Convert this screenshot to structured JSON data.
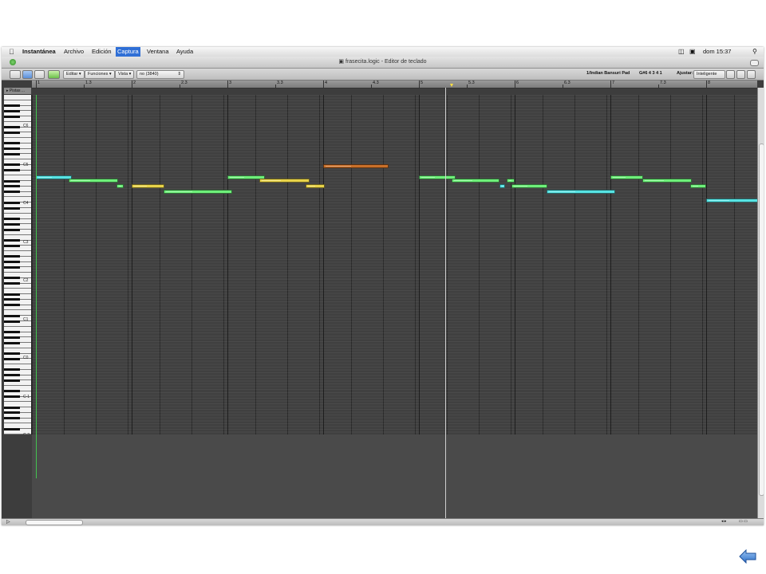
{
  "menubar": {
    "items": [
      "Instantánea",
      "Archivo",
      "Edición",
      "Captura",
      "Ventana",
      "Ayuda"
    ],
    "active_index": 3,
    "clock": "dom 15:37"
  },
  "window": {
    "title": "frasecita.logic - Editor de teclado"
  },
  "toolbar": {
    "edit_menu": "Editar",
    "functions_menu": "Funciones",
    "view_menu": "Vista",
    "quantize_value": "no (3840)",
    "track_name": "1/Indian Bansuri Pad",
    "position": "G#6  4 3 4 1",
    "snap_label": "Ajustar:",
    "snap_value": "Inteligente"
  },
  "ruler": {
    "labels": [
      "1",
      "1.3",
      "2",
      "2.3",
      "3",
      "3.3",
      "4",
      "4.3",
      "5",
      "5.3",
      "6",
      "6.3",
      "7",
      "7.3",
      "8"
    ]
  },
  "inspector": {
    "tab_label": "Pistas ..."
  },
  "keyboard": {
    "octaves": [
      "C6",
      "C5",
      "C4",
      "C3",
      "C2",
      "C1",
      "C0",
      "C-1",
      "C-2"
    ]
  },
  "notes": [
    {
      "start": 0.0,
      "length": 0.375,
      "pitch": 76,
      "color": "#57e3e3"
    },
    {
      "start": 0.34,
      "length": 0.52,
      "pitch": 75,
      "color": "#6ef07a"
    },
    {
      "start": 0.84,
      "length": 0.08,
      "pitch": 73,
      "color": "#6ef07a"
    },
    {
      "start": 1.0,
      "length": 0.34,
      "pitch": 73,
      "color": "#e8d34a"
    },
    {
      "start": 1.33,
      "length": 0.72,
      "pitch": 71,
      "color": "#6ef07a"
    },
    {
      "start": 2.0,
      "length": 0.39,
      "pitch": 76,
      "color": "#6ef07a"
    },
    {
      "start": 2.33,
      "length": 0.53,
      "pitch": 75,
      "color": "#e8d34a"
    },
    {
      "start": 2.82,
      "length": 0.2,
      "pitch": 73,
      "color": "#e8d34a"
    },
    {
      "start": 3.0,
      "length": 0.68,
      "pitch": 80,
      "color": "#c9702a"
    },
    {
      "start": 4.0,
      "length": 0.38,
      "pitch": 76,
      "color": "#6ef07a"
    },
    {
      "start": 4.34,
      "length": 0.5,
      "pitch": 75,
      "color": "#6ef07a"
    },
    {
      "start": 4.84,
      "length": 0.06,
      "pitch": 73,
      "color": "#57e3e3"
    },
    {
      "start": 4.92,
      "length": 0.08,
      "pitch": 75,
      "color": "#6ef07a"
    },
    {
      "start": 4.97,
      "length": 0.37,
      "pitch": 73,
      "color": "#6ef07a"
    },
    {
      "start": 5.33,
      "length": 0.72,
      "pitch": 71,
      "color": "#57e3e3"
    },
    {
      "start": 6.0,
      "length": 0.34,
      "pitch": 76,
      "color": "#6ef07a"
    },
    {
      "start": 6.33,
      "length": 0.52,
      "pitch": 75,
      "color": "#6ef07a"
    },
    {
      "start": 6.83,
      "length": 0.17,
      "pitch": 73,
      "color": "#6ef07a"
    },
    {
      "start": 7.0,
      "length": 0.55,
      "pitch": 68,
      "color": "#57e3e3"
    }
  ],
  "playhead_bar": 4.34
}
